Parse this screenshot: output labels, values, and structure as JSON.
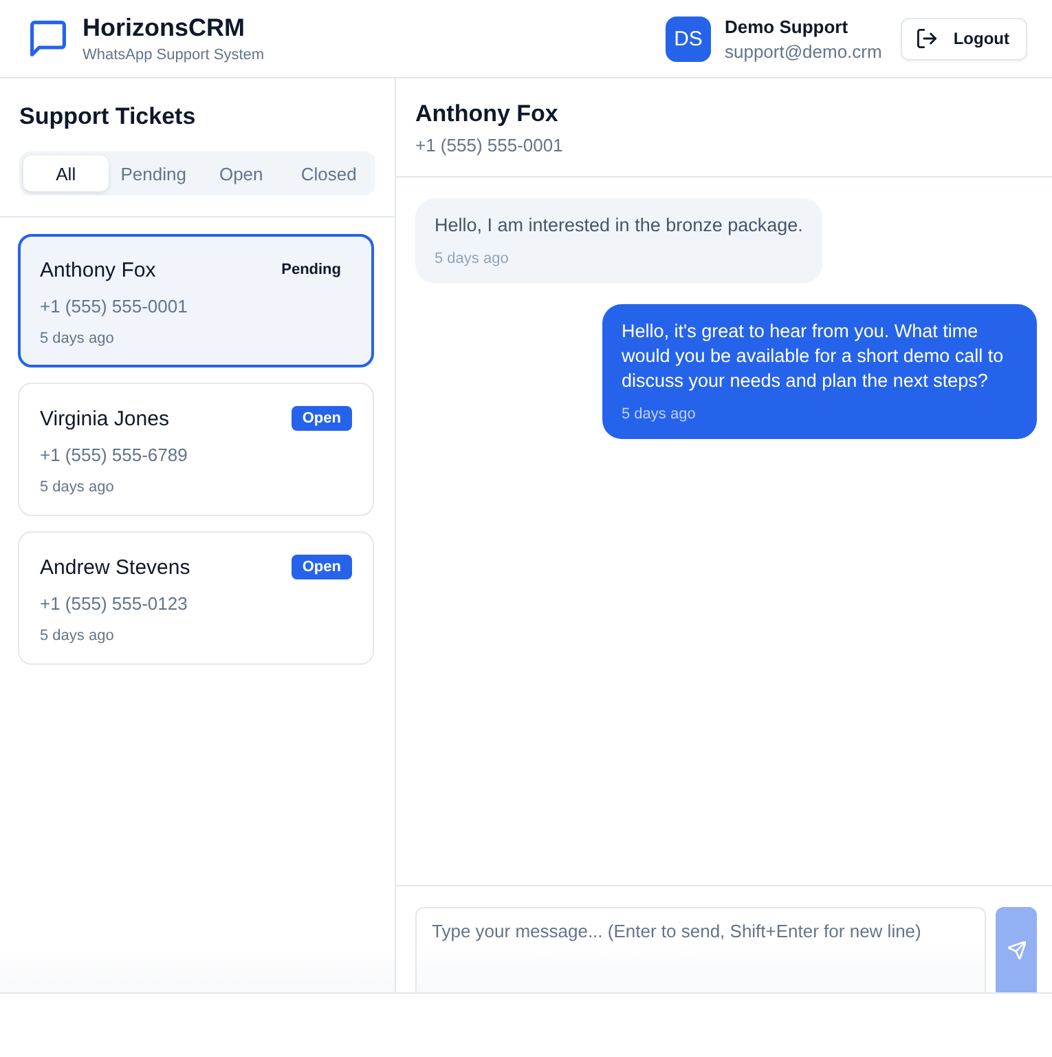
{
  "header": {
    "title": "HorizonsCRM",
    "subtitle": "WhatsApp Support System",
    "user": {
      "initials": "DS",
      "name": "Demo Support",
      "email": "support@demo.crm"
    },
    "logout_button": "Logout"
  },
  "sidebar": {
    "title": "Support Tickets",
    "filter_tabs": [
      {
        "label": "All",
        "selected": true
      },
      {
        "label": "Pending",
        "selected": false
      },
      {
        "label": "Open",
        "selected": false
      },
      {
        "label": "Closed",
        "selected": false
      }
    ],
    "tickets": [
      {
        "name": "Anthony Fox",
        "phone": "+1 (555) 555-0001",
        "time": "5 days ago",
        "status": "Pending",
        "kind": "pending",
        "selected": true
      },
      {
        "name": "Virginia Jones",
        "phone": "+1 (555) 555-6789",
        "time": "5 days ago",
        "status": "Open",
        "kind": "open",
        "selected": false
      },
      {
        "name": "Andrew Stevens",
        "phone": "+1 (555) 555-0123",
        "time": "5 days ago",
        "status": "Open",
        "kind": "open",
        "selected": false
      }
    ]
  },
  "chat": {
    "contact_name": "Anthony Fox",
    "contact_phone": "+1 (555) 555-0001",
    "messages": [
      {
        "kind": "incoming",
        "text": "Hello, I am interested in the bronze package.",
        "time": "5 days ago"
      },
      {
        "kind": "outgoing",
        "text": "Hello, it's great to hear from you. What time would you be available for a short demo call to discuss your needs and plan the next steps?",
        "time": "5 days ago"
      }
    ],
    "composer": {
      "placeholder": "Type your message... (Enter to send, Shift+Enter for new line)",
      "send_disabled": true
    }
  }
}
